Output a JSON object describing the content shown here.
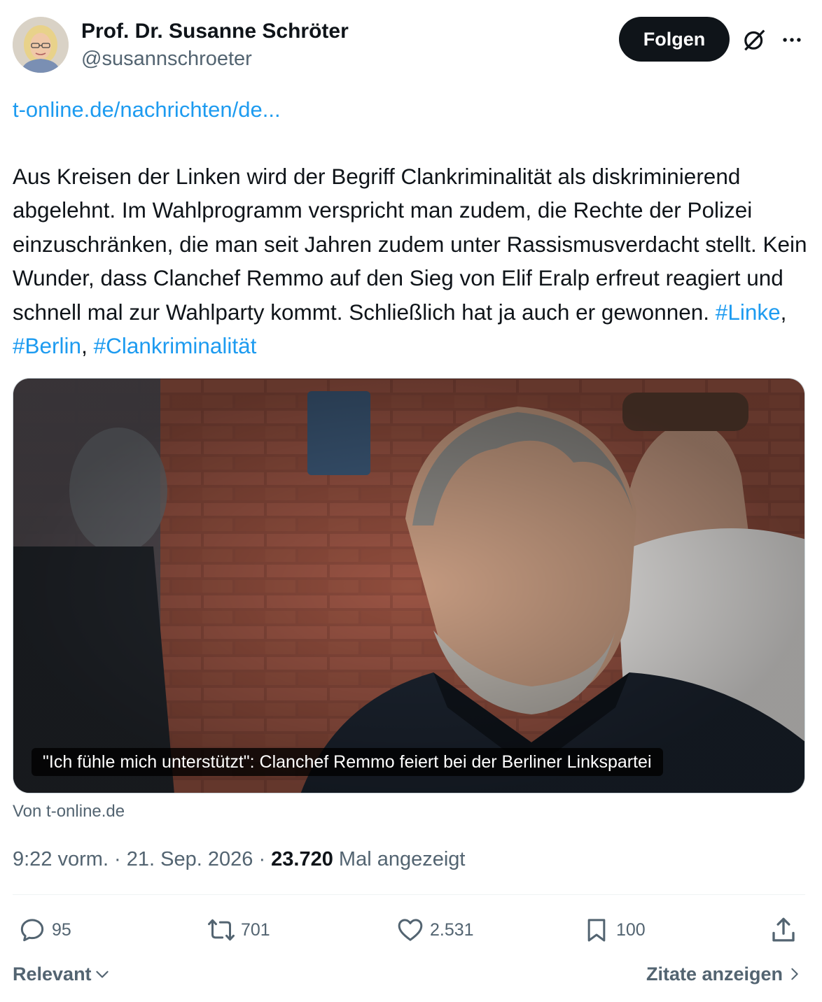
{
  "author": {
    "name": "Prof. Dr. Susanne Schröter",
    "handle": "@susannschroeter",
    "avatar_icon": "avatar-photo"
  },
  "header": {
    "follow_label": "Folgen",
    "grok_icon": "grok-icon",
    "more_icon": "more-icon"
  },
  "tweet": {
    "link": "t-online.de/nachrichten/de...",
    "text": "Aus Kreisen der Linken wird der Begriff Clankriminalität als diskriminierend abgelehnt. Im Wahlprogramm verspricht man zudem, die Rechte der Polizei einzuschränken, die man seit Jahren zudem unter Rassismusverdacht stellt. Kein Wunder, dass Clanchef Remmo auf den Sieg von Elif Eralp erfreut reagiert und schnell mal zur Wahlparty kommt. Schließlich hat ja auch er gewonnen.",
    "hashtags": [
      "#Linke",
      "#Berlin",
      "#Clankriminalität"
    ],
    "hashtag_separator": ", "
  },
  "card": {
    "caption": "\"Ich fühle mich unterstützt\": Clanchef Remmo feiert bei der Berliner Linkspartei",
    "source": "Von t-online.de"
  },
  "meta": {
    "time": "9:22 vorm.",
    "separator": " · ",
    "date": "21. Sep. 2026",
    "views_count": "23.720",
    "views_label": " Mal angezeigt"
  },
  "actions": {
    "replies": "95",
    "reposts": "701",
    "likes": "2.531",
    "bookmarks": "100"
  },
  "footer": {
    "sort_label": "Relevant",
    "quotes_label": "Zitate anzeigen"
  },
  "colors": {
    "link": "#1d9bf0",
    "text": "#0f1419",
    "secondary": "#536471",
    "follow_bg": "#0f1419"
  }
}
